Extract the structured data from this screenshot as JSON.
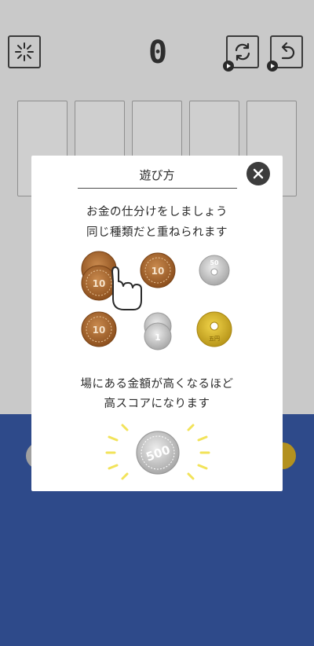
{
  "game": {
    "score": "0",
    "hint_icon": "sparkle-icon",
    "shuffle_icon": "shuffle-icon",
    "undo_icon": "undo-icon",
    "ad_icon": "play-ad-icon",
    "slot_count": 5
  },
  "howto": {
    "title": "遊び方",
    "line1": "お金の仕分けをしましょう",
    "line2": "同じ種類だと重ねられます",
    "line3": "場にある金額が高くなるほど",
    "line4": "高スコアになります",
    "close_icon": "close-icon",
    "coins": {
      "ten_label": "10",
      "fifty_label": "50",
      "one_label": "1",
      "five_label": "五円",
      "five_hundred_label": "500"
    }
  },
  "colors": {
    "background_dim": "#c9c9c9",
    "tray_blue": "#2e4a8a",
    "bronze": "#a5642a",
    "silver": "#c7c7c7",
    "gold": "#d9b520",
    "sparkle": "#f2e35a"
  }
}
